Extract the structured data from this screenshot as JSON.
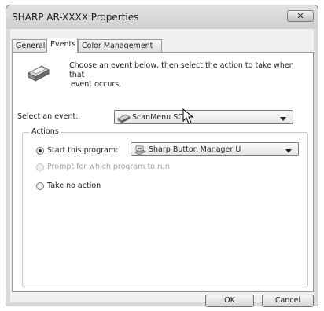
{
  "window": {
    "title": "SHARP AR-XXXX Properties",
    "close_glyph": "✕"
  },
  "tabs": [
    {
      "label": "General"
    },
    {
      "label": "Events"
    },
    {
      "label": "Color Management"
    }
  ],
  "events": {
    "intro_line1": "Choose an event below, then select the action to take when that",
    "intro_line2": "event occurs.",
    "select_label": "Select an event:",
    "selected_event": "ScanMenu SC1"
  },
  "actions": {
    "legend": "Actions",
    "start_program_label": "Start this program:",
    "program_value": "Sharp Button Manager U",
    "prompt_label": "Prompt for which program to run",
    "no_action_label": "Take no action",
    "selected": "start_program"
  },
  "buttons": {
    "ok": "OK",
    "cancel": "Cancel"
  }
}
